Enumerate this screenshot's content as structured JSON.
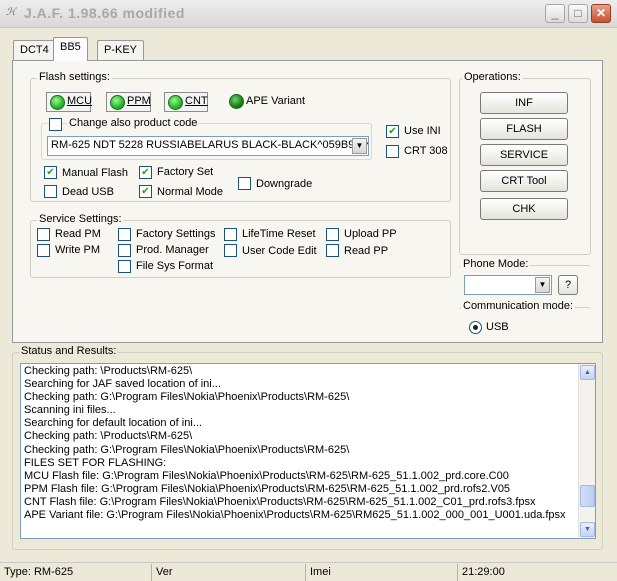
{
  "window": {
    "title": "J.A.F.  1.98.66 modified"
  },
  "tabs": [
    {
      "label": "DCT4"
    },
    {
      "label": "BB5"
    },
    {
      "label": "P-KEY"
    }
  ],
  "flash_settings": {
    "label": "Flash settings:",
    "leds": {
      "mcu": "MCU",
      "ppm": "PPM",
      "cnt": "CNT"
    },
    "ape_variant": "APE Variant",
    "change_product_code": "Change also product code",
    "product_code_value": "RM-625 NDT 5228 RUSSIABELARUS BLACK-BLACK^059B961^",
    "use_ini": "Use INI",
    "crt308": "CRT 308",
    "manual_flash": "Manual Flash",
    "factory_set": "Factory Set",
    "dead_usb": "Dead USB",
    "normal_mode": "Normal Mode",
    "downgrade": "Downgrade"
  },
  "service_settings": {
    "label": "Service Settings:",
    "read_pm": "Read PM",
    "write_pm": "Write PM",
    "factory_settings": "Factory Settings",
    "prod_manager": "Prod. Manager",
    "file_sys_format": "File Sys Format",
    "lifetime_reset": "LifeTime Reset",
    "user_code_edit": "User Code Edit",
    "upload_pp": "Upload PP",
    "read_pp": "Read PP"
  },
  "operations": {
    "label": "Operations:",
    "inf": "INF",
    "flash": "FLASH",
    "service": "SERVICE",
    "crt_tool": "CRT Tool",
    "chk": "CHK"
  },
  "phone_mode": {
    "label": "Phone Mode:",
    "value": "",
    "help": "?"
  },
  "communication_mode": {
    "label": "Communication mode:",
    "usb": "USB"
  },
  "status": {
    "label": "Status and Results:",
    "lines": [
      "Checking path: \\Products\\RM-625\\",
      "Searching for JAF saved location of ini...",
      "Checking path: G:\\Program Files\\Nokia\\Phoenix\\Products\\RM-625\\",
      "Scanning ini files...",
      "Searching for default location of ini...",
      "Checking path: \\Products\\RM-625\\",
      "Checking path: G:\\Program Files\\Nokia\\Phoenix\\Products\\RM-625\\",
      "FILES SET FOR FLASHING:",
      "MCU Flash file: G:\\Program Files\\Nokia\\Phoenix\\Products\\RM-625\\RM-625_51.1.002_prd.core.C00",
      "PPM Flash file: G:\\Program Files\\Nokia\\Phoenix\\Products\\RM-625\\RM-625_51.1.002_prd.rofs2.V05",
      "CNT Flash file: G:\\Program Files\\Nokia\\Phoenix\\Products\\RM-625\\RM-625_51.1.002_C01_prd.rofs3.fpsx",
      "APE Variant file: G:\\Program Files\\Nokia\\Phoenix\\Products\\RM-625\\RM625_51.1.002_000_001_U001.uda.fpsx"
    ]
  },
  "statusbar": {
    "type": "Type: RM-625",
    "ver": "Ver",
    "imei": "Imei",
    "time": "21:29:00"
  },
  "colors": {
    "led_green": "#25b825",
    "background": "#ece9d8"
  },
  "icons": [
    "app-icon",
    "minimize-icon",
    "maximize-icon",
    "close-icon",
    "dropdown-arrow-icon",
    "scroll-up-icon",
    "scroll-down-icon"
  ]
}
